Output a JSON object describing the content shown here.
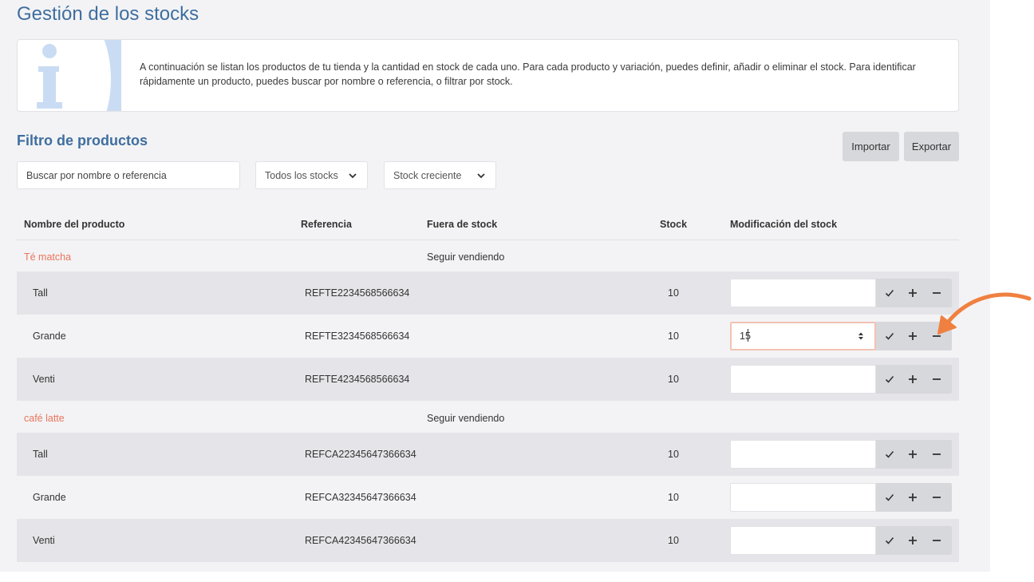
{
  "page": {
    "title": "Gestión de los stocks",
    "info_text": "A continuación se listan los productos de tu tienda y la cantidad en stock de cada uno. Para cada producto y variación, puedes definir, añadir o eliminar el stock. Para identificar rápidamente un producto, puedes buscar por nombre o referencia, o filtrar por stock."
  },
  "filter": {
    "title": "Filtro de productos",
    "search_placeholder": "Buscar por nombre o referencia",
    "stock_filter": "Todos los stocks",
    "sort": "Stock creciente",
    "import_label": "Importar",
    "export_label": "Exportar"
  },
  "table": {
    "headers": {
      "name": "Nombre del producto",
      "reference": "Referencia",
      "out_of_stock": "Fuera de stock",
      "stock": "Stock",
      "modification": "Modificación del stock"
    },
    "products": [
      {
        "name": "Té matcha",
        "out_of_stock": "Seguir vendiendo",
        "variants": [
          {
            "name": "Tall",
            "reference": "REFTE2234568566634",
            "stock": "10",
            "input": ""
          },
          {
            "name": "Grande",
            "reference": "REFTE3234568566634",
            "stock": "10",
            "input": "15"
          },
          {
            "name": "Venti",
            "reference": "REFTE4234568566634",
            "stock": "10",
            "input": ""
          }
        ]
      },
      {
        "name": "café latte",
        "out_of_stock": "Seguir vendiendo",
        "variants": [
          {
            "name": "Tall",
            "reference": "REFCA22345647366634",
            "stock": "10",
            "input": ""
          },
          {
            "name": "Grande",
            "reference": "REFCA32345647366634",
            "stock": "10",
            "input": ""
          },
          {
            "name": "Venti",
            "reference": "REFCA42345647366634",
            "stock": "10",
            "input": ""
          }
        ]
      }
    ]
  },
  "colors": {
    "accent_blue": "#3f6e9f",
    "product_orange": "#e9755d",
    "annotation_arrow": "#f08040"
  },
  "icons": {
    "info": "info-icon",
    "confirm": "check-icon",
    "add": "plus-icon",
    "remove": "minus-icon",
    "dropdown": "chevron-down-icon"
  }
}
